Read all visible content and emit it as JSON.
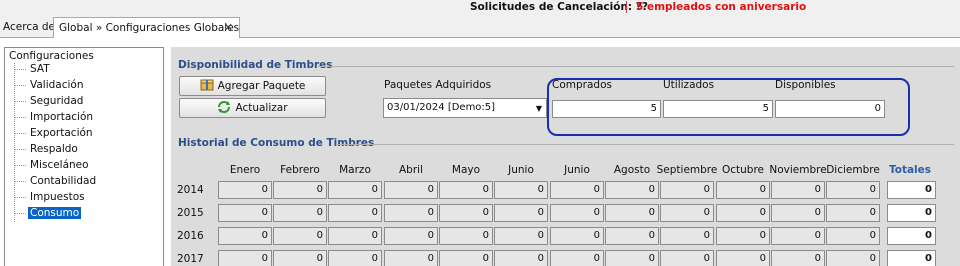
{
  "topbar": {
    "cancel_text": "Solicitudes de Cancelación: ??",
    "anniversary_text": "5 empleados con aniversario"
  },
  "tabs": [
    {
      "label": "Acerca de"
    },
    {
      "label": "Global » Configuraciones Globales",
      "close": "✕"
    }
  ],
  "tree": {
    "root": "Configuraciones",
    "items": [
      "SAT",
      "Validación",
      "Seguridad",
      "Importación",
      "Exportación",
      "Respaldo",
      "Misceláneo",
      "Contabilidad",
      "Impuestos",
      "Consumo"
    ],
    "selected": "Consumo"
  },
  "disponibilidad": {
    "title": "Disponibilidad de Timbres",
    "add_button": "Agregar Paquete",
    "refresh_button": "Actualizar",
    "paquetes_label": "Paquetes Adquiridos",
    "paquete_selected": "03/01/2024 [Demo:5]",
    "comprados_label": "Comprados",
    "utilizados_label": "Utilizados",
    "disponibles_label": "Disponibles",
    "comprados": "5",
    "utilizados": "5",
    "disponibles": "0",
    "highlight_color": "#1a2eb0"
  },
  "historial": {
    "title": "Historial de Consumo de Timbres",
    "months": [
      "Enero",
      "Febrero",
      "Marzo",
      "Abril",
      "Mayo",
      "Junio",
      "Junio",
      "Agosto",
      "Septiembre",
      "Octubre",
      "Noviembre",
      "Diciembre"
    ],
    "totals_label": "Totales",
    "rows": [
      {
        "year": "2014",
        "values": [
          "0",
          "0",
          "0",
          "0",
          "0",
          "0",
          "0",
          "0",
          "0",
          "0",
          "0",
          "0"
        ],
        "total": "0"
      },
      {
        "year": "2015",
        "values": [
          "0",
          "0",
          "0",
          "0",
          "0",
          "0",
          "0",
          "0",
          "0",
          "0",
          "0",
          "0"
        ],
        "total": "0"
      },
      {
        "year": "2016",
        "values": [
          "0",
          "0",
          "0",
          "0",
          "0",
          "0",
          "0",
          "0",
          "0",
          "0",
          "0",
          "0"
        ],
        "total": "0"
      },
      {
        "year": "2017",
        "values": [
          "0",
          "0",
          "0",
          "0",
          "0",
          "0",
          "0",
          "0",
          "0",
          "0",
          "0",
          "0"
        ],
        "total": "0"
      }
    ]
  },
  "icons": {
    "add_package": "package-add-icon",
    "refresh": "refresh-icon"
  }
}
